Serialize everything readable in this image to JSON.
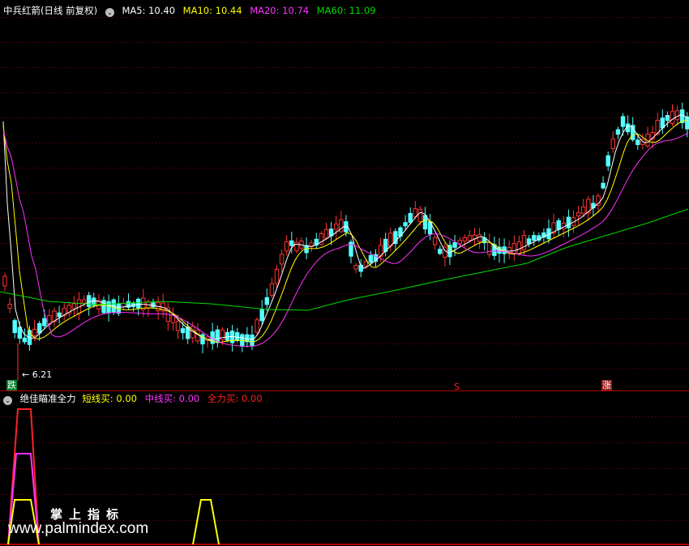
{
  "main_panel": {
    "title": "中兵红箭(日线 前复权)",
    "toggle_icon": "chevron-down-icon",
    "ma": [
      {
        "label": "MA5: 10.40",
        "color": "#ffffff"
      },
      {
        "label": "MA10: 10.44",
        "color": "#ffff00"
      },
      {
        "label": "MA20: 10.74",
        "color": "#ff33ff"
      },
      {
        "label": "MA60: 11.09",
        "color": "#00dd00"
      }
    ],
    "low_marker": "6.21",
    "tag_fall": "跌",
    "tag_s": "S",
    "tag_rise": "涨"
  },
  "indicator_panel": {
    "title": "绝佳瞄准全力",
    "toggle_icon": "chevron-down-icon",
    "values": [
      {
        "label": "短线买: 0.00",
        "color": "#ffff00"
      },
      {
        "label": "中线买: 0.00",
        "color": "#ff33ff"
      },
      {
        "label": "全力买: 0.00",
        "color": "#ff2222"
      }
    ]
  },
  "watermark": {
    "cn": "掌上指标",
    "url": "www.palmindex.com"
  },
  "colors": {
    "background": "#000000",
    "up_candle": "#ff3333",
    "down_candle": "#54ffff",
    "grid": "#8b0000"
  }
}
